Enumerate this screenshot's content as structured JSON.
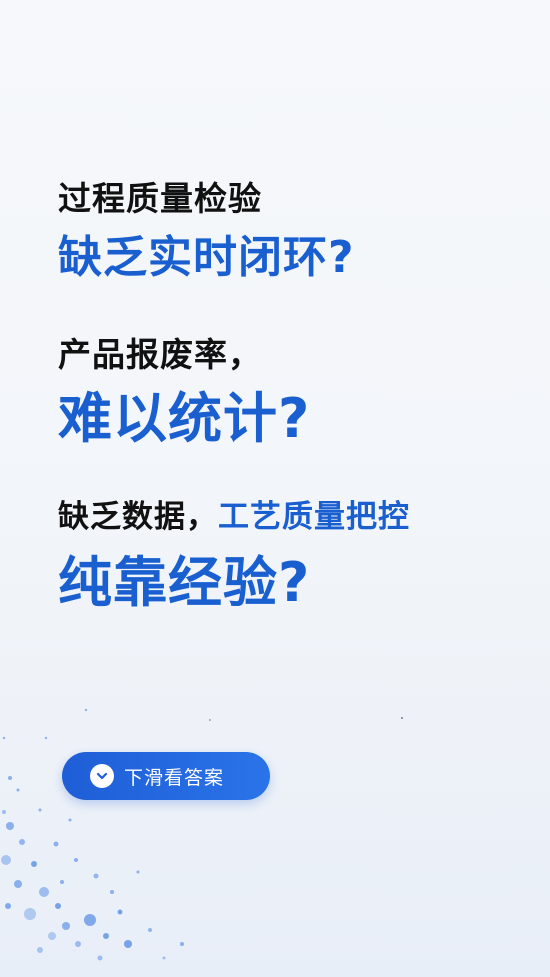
{
  "headline": {
    "line1": "过程质量检验",
    "line2": "缺乏实时闭环?",
    "line3": "产品报废率，",
    "line4": "难以统计?",
    "line5_dark": "缺乏数据，",
    "line5_blue": "工艺质量把控",
    "line6": "纯靠经验?"
  },
  "cta": {
    "label": "下滑看答案",
    "icon": "chevron-down-circle-icon"
  },
  "colors": {
    "primary": "#1a5fd0",
    "text": "#111111",
    "button": "#2a73e8"
  }
}
